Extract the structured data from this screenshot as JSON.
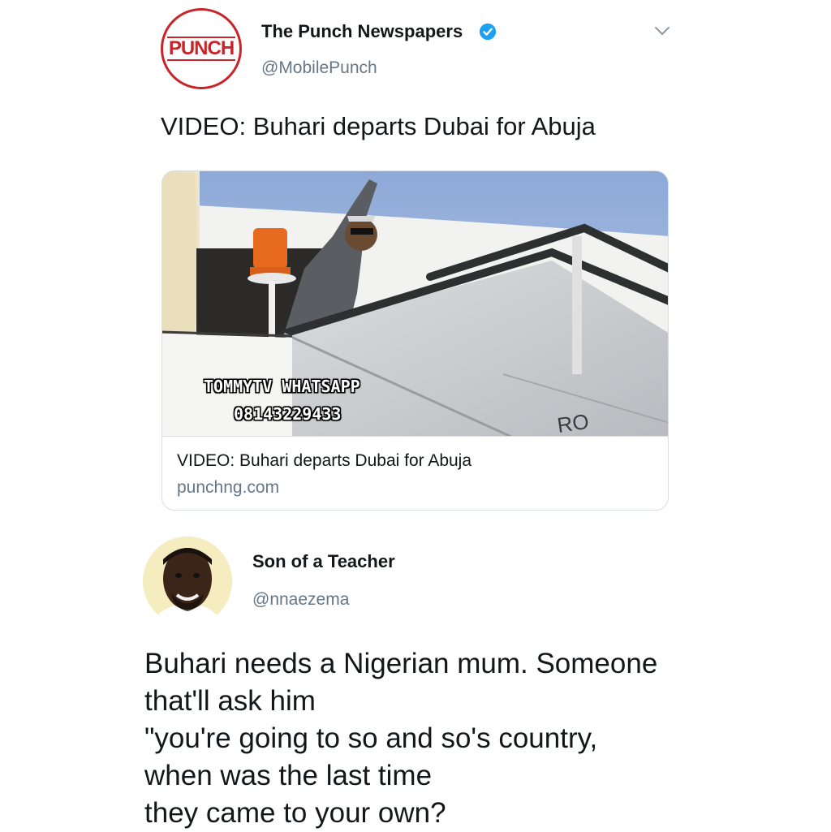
{
  "tweet1": {
    "logo_text": "PUNCH",
    "author_name": "The Punch Newspapers",
    "author_handle": "@MobilePunch",
    "verified": true,
    "text": "VIDEO: Buhari departs Dubai for Abuja",
    "card": {
      "title": "VIDEO: Buhari departs Dubai for Abuja",
      "domain": "punchng.com",
      "watermark_line1": "TOMMYTV WHATSAPP",
      "watermark_line2": "08143229433",
      "stair_text": "RO"
    }
  },
  "tweet2": {
    "author_name": "Son of a Teacher",
    "author_handle": "@nnaezema",
    "lines": [
      "Buhari needs a Nigerian mum. Someone",
      "that'll ask him",
      "\"you're going to so and so's country,",
      "when was the last time",
      "they came to your own?"
    ]
  },
  "colors": {
    "brand_red": "#c8252b",
    "verified_blue": "#1da1f2",
    "secondary_text": "#657786"
  },
  "icons": [
    "verified-badge-icon",
    "chevron-down-icon"
  ]
}
